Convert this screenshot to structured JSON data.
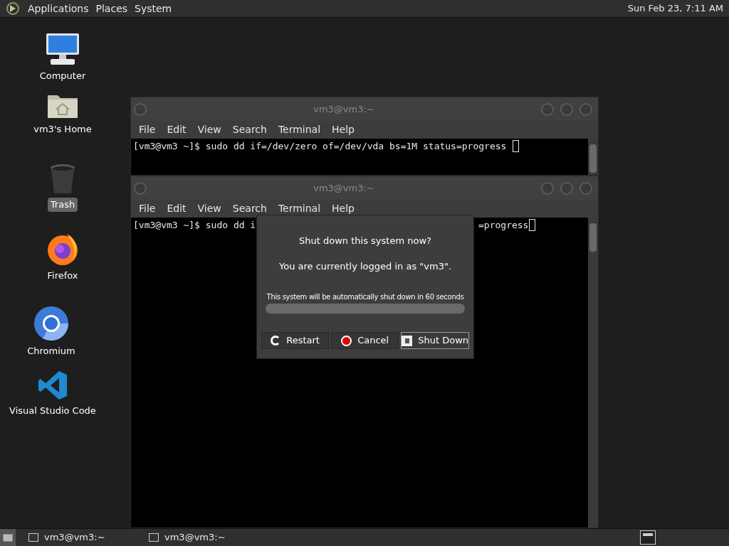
{
  "top_panel": {
    "menus": [
      "Applications",
      "Places",
      "System"
    ],
    "clock": "Sun Feb 23, 7:11 AM"
  },
  "desktop_icons": [
    {
      "label": "Computer",
      "kind": "computer",
      "selected": false
    },
    {
      "label": "vm3's Home",
      "kind": "home",
      "selected": false
    },
    {
      "label": "Trash",
      "kind": "trash",
      "selected": true
    },
    {
      "label": "Firefox",
      "kind": "firefox",
      "selected": false
    },
    {
      "label": "Chromium",
      "kind": "chromium",
      "selected": false
    },
    {
      "label": "Visual Studio Code",
      "kind": "vscode",
      "selected": false
    }
  ],
  "windows": [
    {
      "title": "vm3@vm3:~",
      "menu": [
        "File",
        "Edit",
        "View",
        "Search",
        "Terminal",
        "Help"
      ],
      "segments": [
        "[vm3@vm3 ~]$ sudo dd if=/dev/zero of=/dev/vda bs=1M status=progress"
      ]
    },
    {
      "title": "vm3@vm3:~",
      "menu": [
        "File",
        "Edit",
        "View",
        "Search",
        "Terminal",
        "Help"
      ],
      "segments": [
        "[vm3@vm3 ~]$ sudo dd i",
        "=progress"
      ]
    }
  ],
  "dialog": {
    "question": "Shut down this system now?",
    "logged_in": "You are currently logged in as \"vm3\".",
    "countdown": "This system will be automatically shut down in 60 seconds",
    "progress": {
      "level": 1
    },
    "buttons": [
      {
        "label": "Restart",
        "kind": "restart",
        "selected": false
      },
      {
        "label": "Cancel",
        "kind": "cancel",
        "selected": false
      },
      {
        "label": "Shut Down",
        "kind": "shutdown",
        "selected": true
      }
    ]
  },
  "taskbar": {
    "tasks": [
      "vm3@vm3:~",
      "vm3@vm3:~"
    ]
  }
}
